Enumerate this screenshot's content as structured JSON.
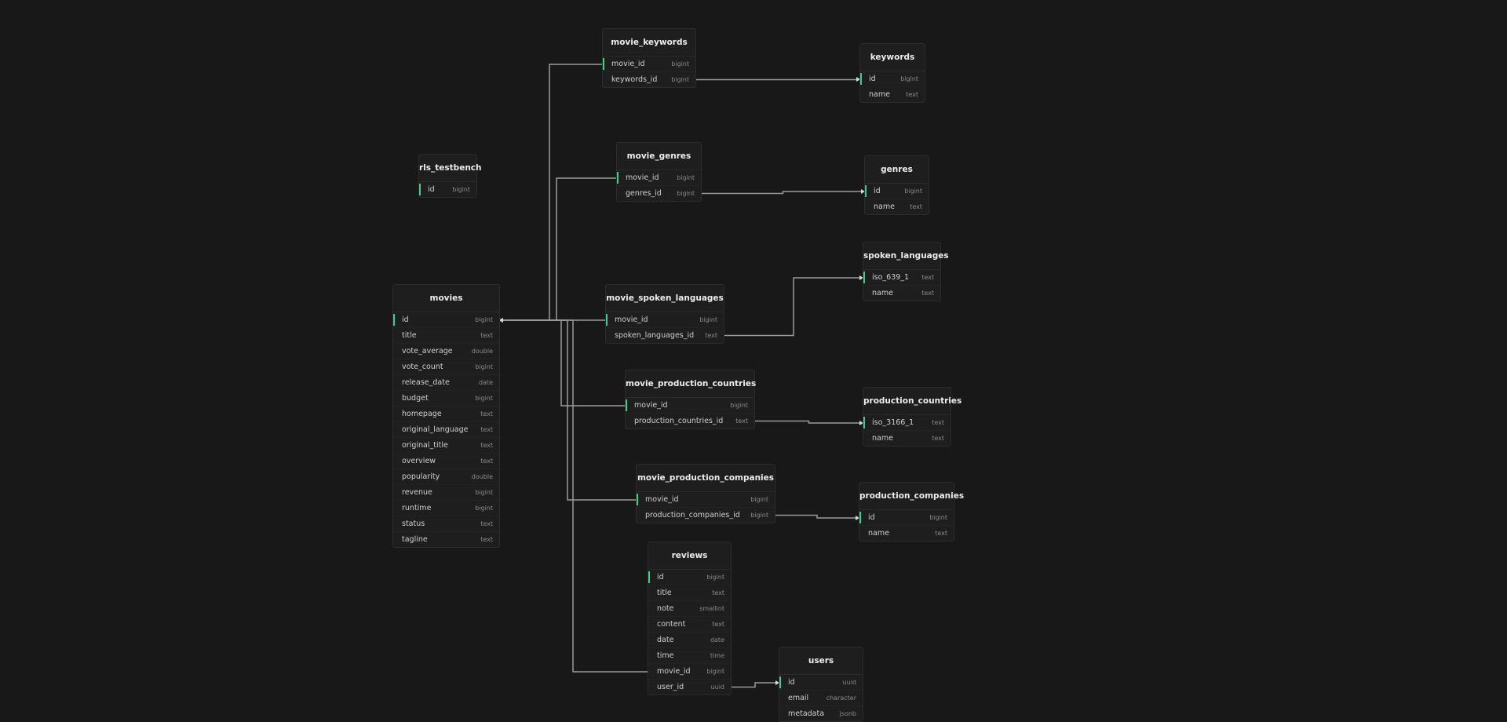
{
  "colors": {
    "background": "#181818",
    "table": "#1e1e1e",
    "primary_key": "#3ecf8e",
    "link": "#9a9a9a"
  },
  "tables": {
    "movie_keywords": {
      "title": "movie_keywords",
      "columns": [
        {
          "name": "movie_id",
          "type": "bigint"
        },
        {
          "name": "keywords_id",
          "type": "bigint"
        }
      ]
    },
    "keywords": {
      "title": "keywords",
      "columns": [
        {
          "name": "id",
          "type": "bigint"
        },
        {
          "name": "name",
          "type": "text"
        }
      ]
    },
    "rls_testbench": {
      "title": "rls_testbench",
      "columns": [
        {
          "name": "id",
          "type": "bigint"
        }
      ]
    },
    "movie_genres": {
      "title": "movie_genres",
      "columns": [
        {
          "name": "movie_id",
          "type": "bigint"
        },
        {
          "name": "genres_id",
          "type": "bigint"
        }
      ]
    },
    "genres": {
      "title": "genres",
      "columns": [
        {
          "name": "id",
          "type": "bigint"
        },
        {
          "name": "name",
          "type": "text"
        }
      ]
    },
    "spoken_languages": {
      "title": "spoken_languages",
      "columns": [
        {
          "name": "iso_639_1",
          "type": "text"
        },
        {
          "name": "name",
          "type": "text"
        }
      ]
    },
    "movies": {
      "title": "movies",
      "columns": [
        {
          "name": "id",
          "type": "bigint"
        },
        {
          "name": "title",
          "type": "text"
        },
        {
          "name": "vote_average",
          "type": "double"
        },
        {
          "name": "vote_count",
          "type": "bigint"
        },
        {
          "name": "release_date",
          "type": "date"
        },
        {
          "name": "budget",
          "type": "bigint"
        },
        {
          "name": "homepage",
          "type": "text"
        },
        {
          "name": "original_language",
          "type": "text"
        },
        {
          "name": "original_title",
          "type": "text"
        },
        {
          "name": "overview",
          "type": "text"
        },
        {
          "name": "popularity",
          "type": "double"
        },
        {
          "name": "revenue",
          "type": "bigint"
        },
        {
          "name": "runtime",
          "type": "bigint"
        },
        {
          "name": "status",
          "type": "text"
        },
        {
          "name": "tagline",
          "type": "text"
        }
      ]
    },
    "movie_spoken_languages": {
      "title": "movie_spoken_languages",
      "columns": [
        {
          "name": "movie_id",
          "type": "bigint"
        },
        {
          "name": "spoken_languages_id",
          "type": "text"
        }
      ]
    },
    "movie_production_countries": {
      "title": "movie_production_countries",
      "columns": [
        {
          "name": "movie_id",
          "type": "bigint"
        },
        {
          "name": "production_countries_id",
          "type": "text"
        }
      ]
    },
    "production_countries": {
      "title": "production_countries",
      "columns": [
        {
          "name": "iso_3166_1",
          "type": "text"
        },
        {
          "name": "name",
          "type": "text"
        }
      ]
    },
    "movie_production_companies": {
      "title": "movie_production_companies",
      "columns": [
        {
          "name": "movie_id",
          "type": "bigint"
        },
        {
          "name": "production_companies_id",
          "type": "bigint"
        }
      ]
    },
    "production_companies": {
      "title": "production_companies",
      "columns": [
        {
          "name": "id",
          "type": "bigint"
        },
        {
          "name": "name",
          "type": "text"
        }
      ]
    },
    "reviews": {
      "title": "reviews",
      "columns": [
        {
          "name": "id",
          "type": "bigint"
        },
        {
          "name": "title",
          "type": "text"
        },
        {
          "name": "note",
          "type": "smallint"
        },
        {
          "name": "content",
          "type": "text"
        },
        {
          "name": "date",
          "type": "date"
        },
        {
          "name": "time",
          "type": "time"
        },
        {
          "name": "movie_id",
          "type": "bigint"
        },
        {
          "name": "user_id",
          "type": "uuid"
        }
      ]
    },
    "users": {
      "title": "users",
      "columns": [
        {
          "name": "id",
          "type": "uuid"
        },
        {
          "name": "email",
          "type": "character"
        },
        {
          "name": "metadata",
          "type": "jsonb"
        }
      ]
    }
  },
  "relations": [
    {
      "from": "movie_keywords.movie_id",
      "to": "movies.id"
    },
    {
      "from": "movie_keywords.keywords_id",
      "to": "keywords.id"
    },
    {
      "from": "movie_genres.movie_id",
      "to": "movies.id"
    },
    {
      "from": "movie_genres.genres_id",
      "to": "genres.id"
    },
    {
      "from": "movie_spoken_languages.movie_id",
      "to": "movies.id"
    },
    {
      "from": "movie_spoken_languages.spoken_languages_id",
      "to": "spoken_languages.iso_639_1"
    },
    {
      "from": "movie_production_countries.movie_id",
      "to": "movies.id"
    },
    {
      "from": "movie_production_countries.production_countries_id",
      "to": "production_countries.iso_3166_1"
    },
    {
      "from": "movie_production_companies.movie_id",
      "to": "movies.id"
    },
    {
      "from": "movie_production_companies.production_companies_id",
      "to": "production_companies.id"
    },
    {
      "from": "reviews.movie_id",
      "to": "movies.id"
    },
    {
      "from": "reviews.user_id",
      "to": "users.id"
    }
  ]
}
